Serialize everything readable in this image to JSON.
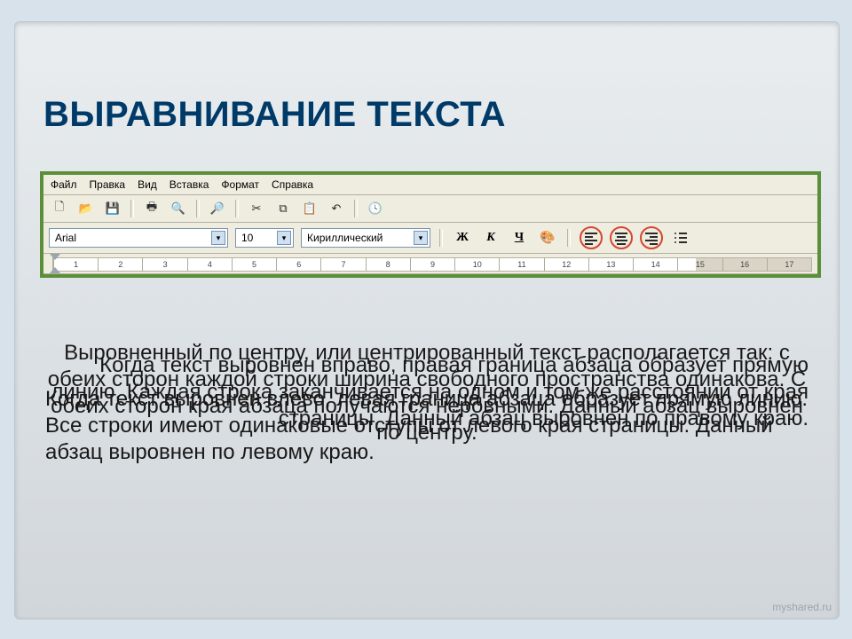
{
  "slide": {
    "title": "ВЫРАВНИВАНИЕ ТЕКСТА"
  },
  "menubar": {
    "file": "Файл",
    "edit": "Правка",
    "view": "Вид",
    "insert": "Вставка",
    "format": "Формат",
    "help": "Справка"
  },
  "format_bar": {
    "font": "Arial",
    "size": "10",
    "script": "Кириллический",
    "bold_label": "Ж",
    "italic_label": "К",
    "underline_label": "Ч"
  },
  "ruler": {
    "ticks": [
      "1",
      "2",
      "3",
      "4",
      "5",
      "6",
      "7",
      "8",
      "9",
      "10",
      "11",
      "12",
      "13",
      "14",
      "15",
      "16",
      "17"
    ]
  },
  "paragraphs": {
    "left": "Когда текст выровнен влево, левая граница абзаца образует прямую линию. Все строки имеют одинаковые отступы от левого края страницы. Данный абзац выровнен по левому краю.",
    "center": "Выровненный по центру, или центрированный текст располагается так: с обеих сторон каждой строки ширина свободного пространства одинакова. С обеих сторон края абзаца получаются неровными. Данный абзац выровнен по центру.",
    "right": "Когда текст выровнен вправо, правая граница абзаца образует прямую линию. Каждая строка заканчивается на одном и том же расстоянии от края страницы. Данный абзац выровнен по правому краю."
  },
  "watermark": "myshared.ru"
}
